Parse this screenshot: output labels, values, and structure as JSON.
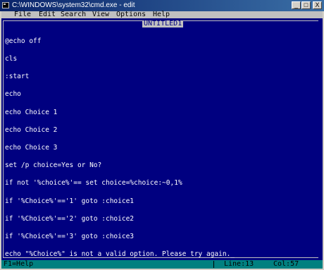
{
  "window": {
    "title": "C:\\WINDOWS\\system32\\cmd.exe - edit",
    "minimize_glyph": "_",
    "maximize_glyph": "□",
    "close_glyph": "X"
  },
  "menu": {
    "items": [
      "File",
      "Edit",
      "Search",
      "View",
      "Options",
      "Help"
    ]
  },
  "editor": {
    "document_title": "UNTITLED1",
    "lines": [
      "@echo off",
      "cls",
      ":start",
      "echo",
      "echo Choice 1",
      "echo Choice 2",
      "echo Choice 3",
      "set /p choice=Yes or No?",
      "if not '%choice%'== set choice=%choice:~0,1%",
      "if '%Choice%'=='1' goto :choice1",
      "if '%Choice%'=='2' goto :choice2",
      "if '%Choice%'=='3' goto :choice3",
      "echo \"%Choice%\" is not a valid option. Please try again."
    ],
    "cursor": "_"
  },
  "status": {
    "help": "F1=Help",
    "line": "Line:13",
    "col": "Col:57"
  },
  "colors": {
    "title_bar": "#0a246a",
    "editor_bg": "#000080",
    "status_bg": "#008080",
    "menu_bg": "#c0c0c0"
  }
}
